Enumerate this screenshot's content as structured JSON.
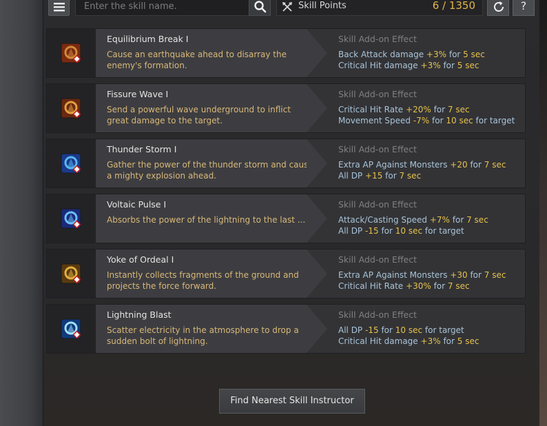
{
  "search": {
    "placeholder": "Enter the skill name."
  },
  "skill_points": {
    "label": "Skill Points",
    "value": "6 / 1350"
  },
  "help_label": "?",
  "addon_title": "Skill Add-on Effect",
  "skills": [
    {
      "name": "Equilibrium Break I",
      "desc": "Cause an earthquake ahead to disarray the enemy's formation.",
      "icon": "earth-fist-icon",
      "icon_colors": [
        "#7a2a10",
        "#d08a3a"
      ],
      "effects": [
        {
          "stat": "Back Attack damage",
          "value": "+3%",
          "for": "for",
          "duration": "5 sec",
          "target": ""
        },
        {
          "stat": "Critical Hit damage",
          "value": "+3%",
          "for": "for",
          "duration": "5 sec",
          "target": ""
        }
      ]
    },
    {
      "name": "Fissure Wave I",
      "desc": "Send a powerful wave underground to inflict great damage to the target.",
      "icon": "fissure-icon",
      "icon_colors": [
        "#6a2810",
        "#e0a040"
      ],
      "effects": [
        {
          "stat": "Critical Hit Rate",
          "value": "+20%",
          "for": "for",
          "duration": "7 sec",
          "target": ""
        },
        {
          "stat": "Movement Speed",
          "value": "-7%",
          "for": "for",
          "duration": "10 sec",
          "target": "for target"
        }
      ]
    },
    {
      "name": "Thunder Storm I",
      "desc": "Gather the power of the thunder storm and cause a mighty explosion ahead.",
      "icon": "thunder-storm-icon",
      "icon_colors": [
        "#1a3a8a",
        "#58b8f0"
      ],
      "effects": [
        {
          "stat": "Extra AP Against Monsters",
          "value": "+20",
          "for": "for",
          "duration": "7 sec",
          "target": ""
        },
        {
          "stat": "All DP",
          "value": "+15",
          "for": "for",
          "duration": "7 sec",
          "target": ""
        }
      ]
    },
    {
      "name": "Voltaic Pulse I",
      "desc": "Absorbs the power of the lightning to the last ...",
      "icon": "voltaic-pulse-icon",
      "icon_colors": [
        "#1a2a7a",
        "#6ac0f8"
      ],
      "effects": [
        {
          "stat": "Attack/Casting Speed",
          "value": "+7%",
          "for": "for",
          "duration": "7 sec",
          "target": ""
        },
        {
          "stat": "All DP",
          "value": "-15",
          "for": "for",
          "duration": "10 sec",
          "target": "for target"
        }
      ]
    },
    {
      "name": "Yoke of Ordeal I",
      "desc": "Instantly collects fragments of the ground and projects the force forward.",
      "icon": "yoke-icon",
      "icon_colors": [
        "#5a3a10",
        "#e0b040"
      ],
      "effects": [
        {
          "stat": "Extra AP Against Monsters",
          "value": "+30",
          "for": "for",
          "duration": "7 sec",
          "target": ""
        },
        {
          "stat": "Critical Hit Rate",
          "value": "+30%",
          "for": "for",
          "duration": "7 sec",
          "target": ""
        }
      ]
    },
    {
      "name": "Lightning Blast",
      "desc": "Scatter electricity in the atmosphere to drop a sudden bolt of lightning.",
      "icon": "lightning-blast-icon",
      "icon_colors": [
        "#103a7a",
        "#a0e0ff"
      ],
      "effects": [
        {
          "stat": "All DP",
          "value": "-15",
          "for": "for",
          "duration": "10 sec",
          "target": "for target"
        },
        {
          "stat": "Critical Hit damage",
          "value": "+3%",
          "for": "for",
          "duration": "5 sec",
          "target": ""
        }
      ]
    }
  ],
  "find_button": "Find Nearest Skill Instructor"
}
